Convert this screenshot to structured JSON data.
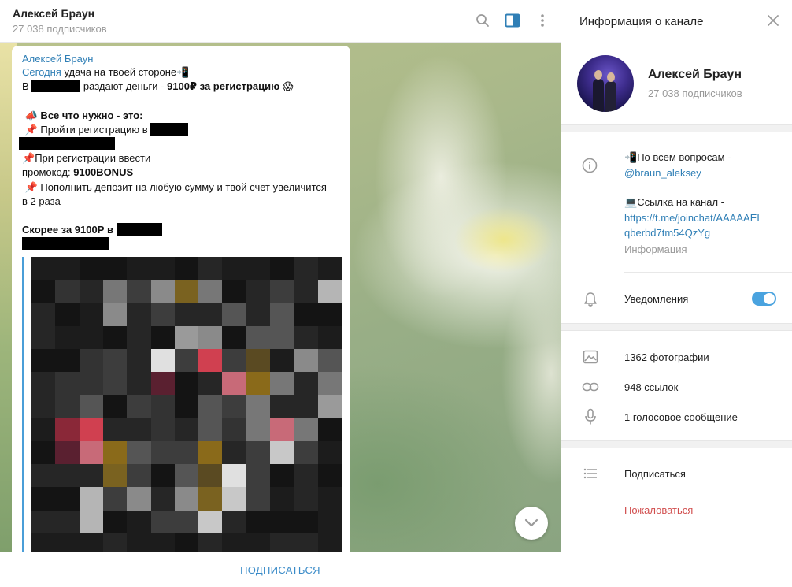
{
  "chat": {
    "title": "Алексей Браун",
    "subscribers": "27 038 подписчиков",
    "message": {
      "author": "Алексей Браун",
      "line1_link": "Сегодня",
      "line1_rest": " удача на твоей стороне",
      "line2_pre": "В ",
      "line2_mid": " раздают деньги - ",
      "line2_bold": "9100₽ за регистрацию",
      "line4_bold": " Все что нужно - это:",
      "line5": " Пройти регистрацию в ",
      "line7": "При регистрации ввести",
      "line8_pre": "промокод: ",
      "line8_bold": "9100BONUS",
      "line9": " Пополнить депозит на любую сумму и твой счет увеличится",
      "line10": "в 2 раза",
      "line12_bold": "Скорее за 9100Р в"
    },
    "subscribe_label": "ПОДПИСАТЬСЯ",
    "icons": {
      "search": "search-icon",
      "panel": "sidebar-toggle-icon",
      "more": "more-vertical-icon",
      "scroll": "chevron-down-icon"
    }
  },
  "info": {
    "title": "Информация о канале",
    "name": "Алексей Браун",
    "subscribers": "27 038 подписчиков",
    "description": {
      "q_prefix": "По всем вопросам -",
      "q_handle": "@braun_aleksey",
      "link_prefix": "Ссылка на канал -",
      "link_line1": "https://t.me/joinchat/AAAAAEL",
      "link_line2": "qberbd7tm54QzYg",
      "caption": "Информация"
    },
    "notifications_label": "Уведомления",
    "notifications_on": true,
    "media": {
      "photos": "1362 фотографии",
      "links": "948 ссылок",
      "voice": "1 голосовое сообщение"
    },
    "subscribe_label": "Подписаться",
    "report_label": "Пожаловаться"
  },
  "colors": {
    "accent": "#2f7fb6",
    "report": "#d14e4e",
    "toggle": "#4aa3df",
    "muted": "#999999"
  }
}
